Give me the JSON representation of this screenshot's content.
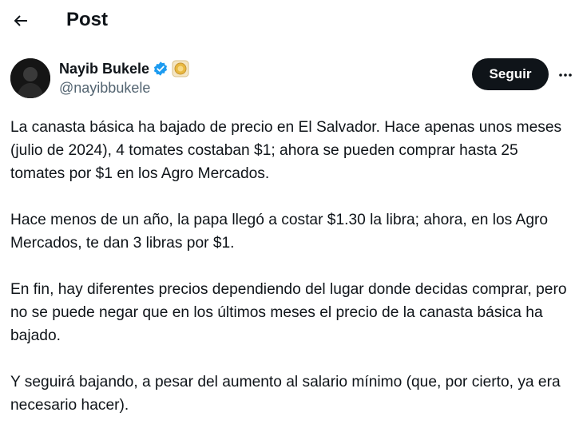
{
  "header": {
    "title": "Post"
  },
  "author": {
    "display_name": "Nayib Bukele",
    "handle": "@nayibbukele",
    "verified_badge": "verified-icon",
    "affiliation_badge": "gold-seal-icon"
  },
  "actions": {
    "follow_label": "Seguir"
  },
  "post": {
    "paragraphs": [
      "La canasta básica ha bajado de precio en El Salvador. Hace apenas unos meses (julio de 2024), 4 tomates costaban $1; ahora se pueden comprar hasta 25 tomates por $1 en los Agro Mercados.",
      "Hace menos de un año, la papa llegó a costar $1.30 la libra; ahora, en los Agro Mercados, te dan 3 libras por $1.",
      "En fin, hay diferentes precios dependiendo del lugar donde decidas comprar, pero no se puede negar que en los últimos meses el precio de la canasta básica ha bajado.",
      "Y seguirá bajando, a pesar del aumento al salario mínimo (que, por cierto, ya era necesario hacer)."
    ]
  },
  "colors": {
    "text_primary": "#0f1419",
    "text_secondary": "#536471",
    "verified_blue": "#1d9bf0",
    "follow_bg": "#0f1419"
  }
}
